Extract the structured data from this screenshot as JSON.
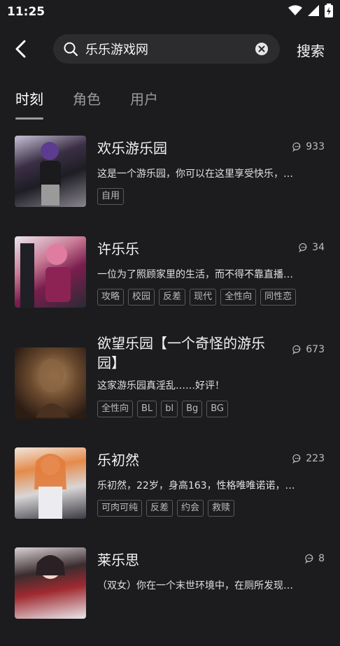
{
  "status": {
    "time": "11:25"
  },
  "header": {
    "search_value": "乐乐游戏网",
    "search_button": "搜索"
  },
  "tabs": [
    {
      "label": "时刻"
    },
    {
      "label": "角色"
    },
    {
      "label": "用户"
    }
  ],
  "items": [
    {
      "title": "欢乐游乐园",
      "count": "933",
      "desc": "这是一个游乐园，你可以在这里享受快乐，…",
      "tags": [
        "自用"
      ]
    },
    {
      "title": "许乐乐",
      "count": "34",
      "desc": "一位为了照顾家里的生活，而不得不靠直播…",
      "tags": [
        "攻略",
        "校园",
        "反差",
        "现代",
        "全性向",
        "同性恋"
      ]
    },
    {
      "title_line1": "欲望乐园【一个奇怪的游乐",
      "title_line2": "园】",
      "count": "673",
      "desc": "这家游乐园真淫乱……好评！",
      "tags": [
        "全性向",
        "BL",
        "bl",
        "Bg",
        "BG"
      ]
    },
    {
      "title": "乐初然",
      "count": "223",
      "desc": "乐初然，22岁，身高163，性格唯唯诺诺，…",
      "tags": [
        "可肉可纯",
        "反差",
        "约会",
        "救赎"
      ]
    },
    {
      "title": "莱乐思",
      "count": "8",
      "desc": "（双女）你在一个末世环境中，在厕所发现…"
    }
  ]
}
